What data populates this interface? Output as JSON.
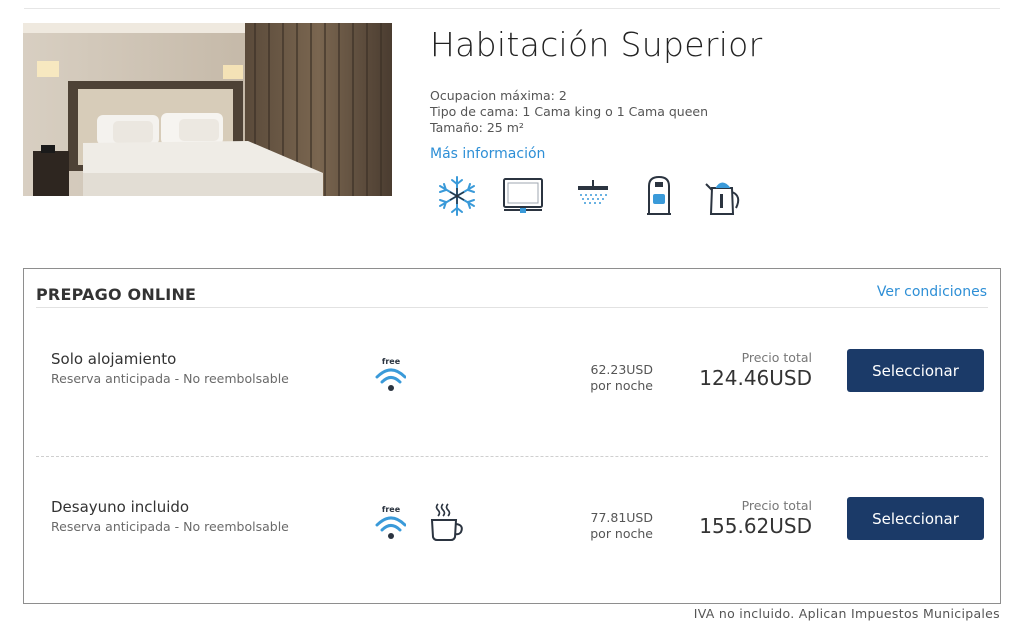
{
  "room": {
    "title": "Habitación Superior",
    "max_occupancy": "Ocupacion máxima: 2",
    "bed_type": "Tipo de cama: 1 Cama king o 1 Cama queen",
    "size": "Tamaño: 25 m²",
    "more_info": "Más información",
    "amenities": [
      "snowflake-icon",
      "tv-icon",
      "shower-icon",
      "safe-icon",
      "kettle-icon"
    ]
  },
  "rates": {
    "type_label": "PREPAGO ONLINE",
    "conditions_link": "Ver condiciones",
    "rows": [
      {
        "name": "Solo alojamiento",
        "subtitle": "Reserva anticipada - No reembolsable",
        "wifi_label": "free",
        "nightly_price": "62.23USD",
        "per_night": "por noche",
        "total_label": "Precio total",
        "total_price": "124.46USD",
        "button": "Seleccionar"
      },
      {
        "name": "Desayuno incluido",
        "subtitle": "Reserva anticipada - No reembolsable",
        "wifi_label": "free",
        "nightly_price": "77.81USD",
        "per_night": "por noche",
        "total_label": "Precio total",
        "total_price": "155.62USD",
        "button": "Seleccionar"
      }
    ]
  },
  "footnote": "IVA no incluido. Aplican Impuestos Municipales",
  "colors": {
    "link": "#2e8fd6",
    "button": "#1b3a68",
    "icon_blue": "#3a9ad9",
    "icon_dark": "#2b3440"
  }
}
